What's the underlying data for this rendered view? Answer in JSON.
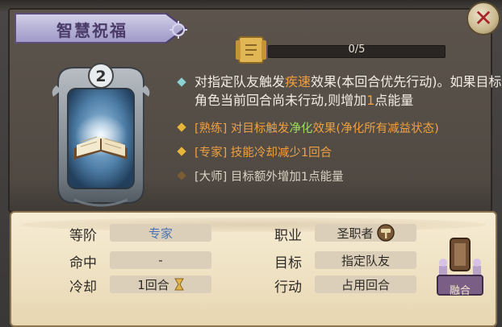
{
  "title": "智慧祝福",
  "card": {
    "level": "2"
  },
  "progress": {
    "current": 0,
    "max": 5,
    "text": "0/5"
  },
  "effects": {
    "main": {
      "p1": "对指定队友触发",
      "kw": "疾速",
      "p2": "效果(本回合优先行动)。如果目标角色当前回合尚未行动,则增加",
      "num": "1",
      "p3": "点能量"
    },
    "perks": [
      {
        "tag": "[熟练]",
        "p1": " 对目标触发",
        "kw": "净化",
        "p2": "效果(净化所有减益状态)",
        "tier": "unlocked-gold"
      },
      {
        "tag": "[专家]",
        "p1": " 技能冷却减少1回合",
        "tier": "unlocked-gold"
      },
      {
        "tag": "[大师]",
        "p1": " 目标额外增加1点能量",
        "tier": "locked"
      }
    ]
  },
  "stats": {
    "rank_label": "等阶",
    "rank_value": "专家",
    "hit_label": "命中",
    "hit_value": "-",
    "cooldown_label": "冷却",
    "cooldown_value": "1回合",
    "class_label": "职业",
    "class_value": "圣职者",
    "target_label": "目标",
    "target_value": "指定队友",
    "action_label": "行动",
    "action_value": "占用回合"
  },
  "fuse_label": "融合",
  "colors": {
    "accent_orange": "#f0a040",
    "accent_green": "#9bdf5a",
    "gold_diamond": "#e6b53a",
    "teal_diamond": "#8cd3d3",
    "locked_diamond": "#7a5d35",
    "rank_blue": "#4a74b6"
  },
  "icons": [
    "close-icon",
    "scroll-badge-icon",
    "hourglass-icon",
    "hammer-icon",
    "book-icon"
  ]
}
